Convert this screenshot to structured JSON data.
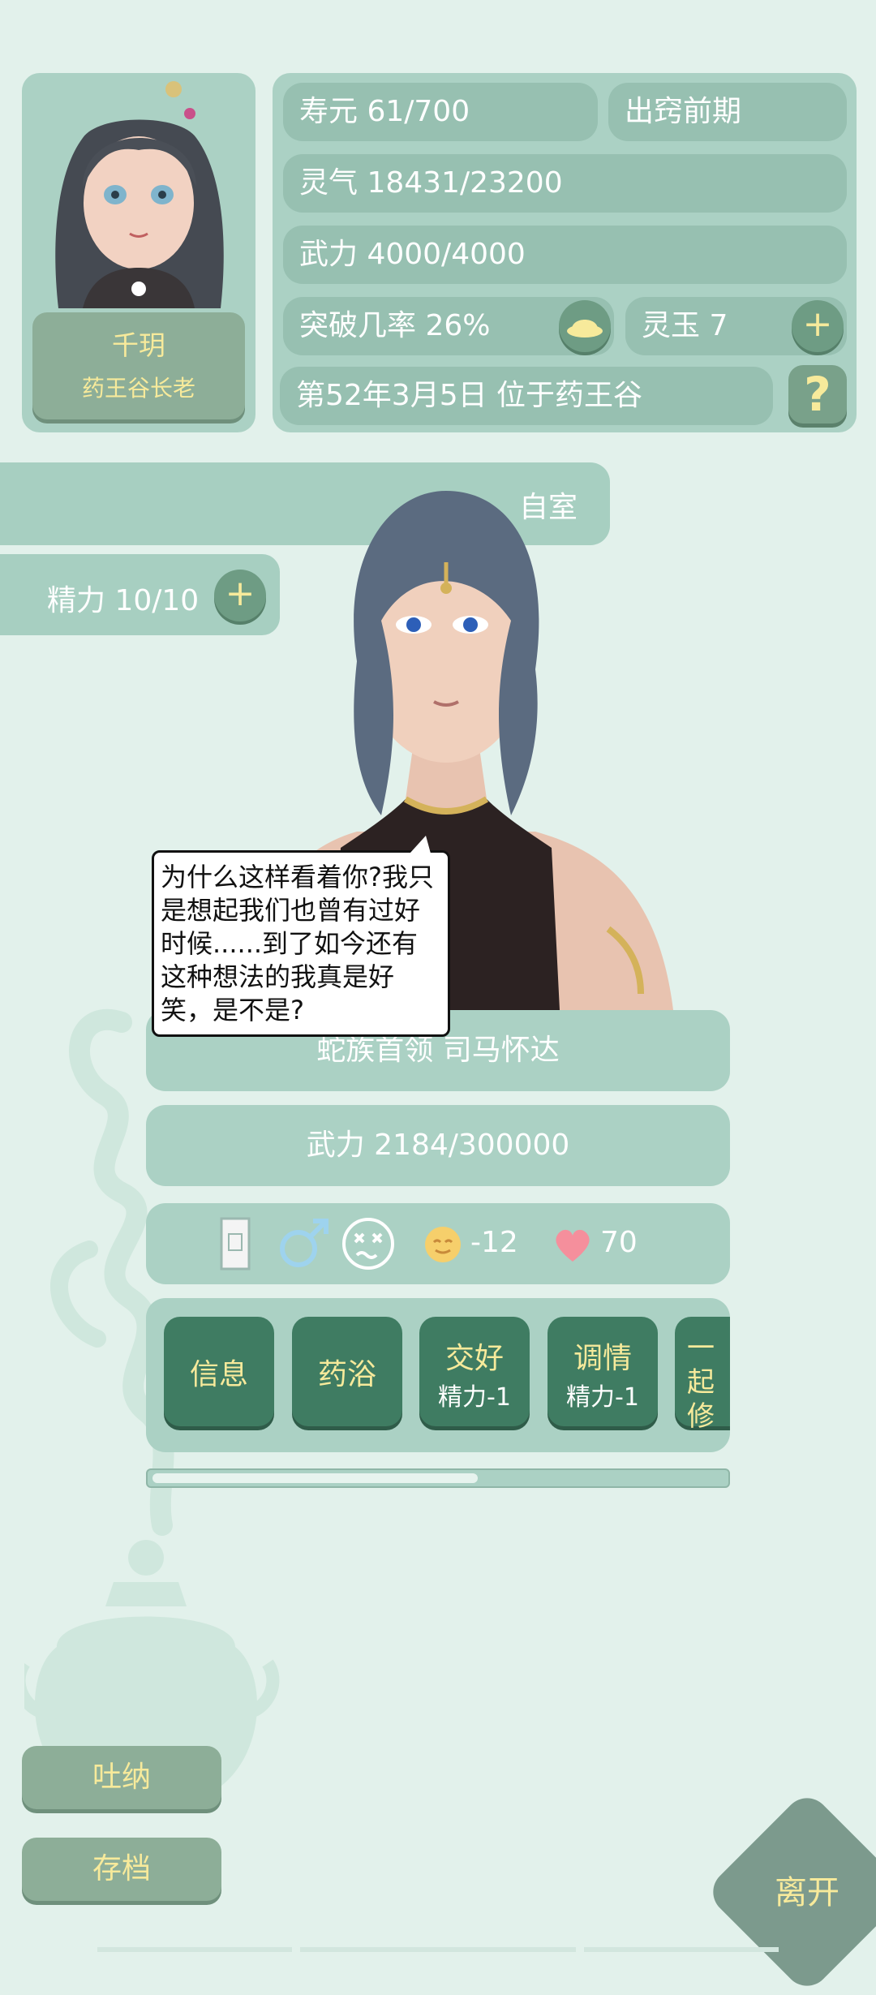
{
  "player": {
    "name": "千玥",
    "title": "药王谷长老"
  },
  "stats": {
    "lifespan": "寿元 61/700",
    "realm": "出窍前期",
    "spirit": "灵气 18431/23200",
    "power": "武力 4000/4000",
    "breakthrough": "突破几率 26%",
    "jade": "灵玉 7",
    "date_location": "第52年3月5日 位于药王谷"
  },
  "room": {
    "label": "自室"
  },
  "stamina": {
    "label": "精力 10/10"
  },
  "npc": {
    "dialogue": "为什么这样看着你?我只是想起我们也曾有过好时候......到了如今还有这种想法的我真是好笑，是不是?",
    "name": "蛇族首领 司马怀达",
    "power": "武力 2184/300000",
    "mood_value": "-12",
    "affection_value": "70",
    "actions": [
      {
        "label": "信息",
        "cost": ""
      },
      {
        "label": "药浴",
        "cost": ""
      },
      {
        "label": "交好",
        "cost": "精力-1"
      },
      {
        "label": "调情",
        "cost": "精力-1"
      },
      {
        "label": "一起修",
        "cost": ""
      }
    ],
    "scroll_fraction": 0.57
  },
  "buttons": {
    "breathe": "吐纳",
    "save": "存档",
    "leave": "离开"
  },
  "colors": {
    "background": "#e2f1eb",
    "panel": "#abd1c4",
    "action_button": "#3f7c62",
    "gold_text": "#f7ea9b"
  },
  "icons": [
    "plus-icon",
    "help-icon",
    "breakthrough-icon",
    "talisman-icon",
    "male-icon",
    "dizzy-face-icon",
    "mood-face-icon",
    "heart-icon"
  ]
}
